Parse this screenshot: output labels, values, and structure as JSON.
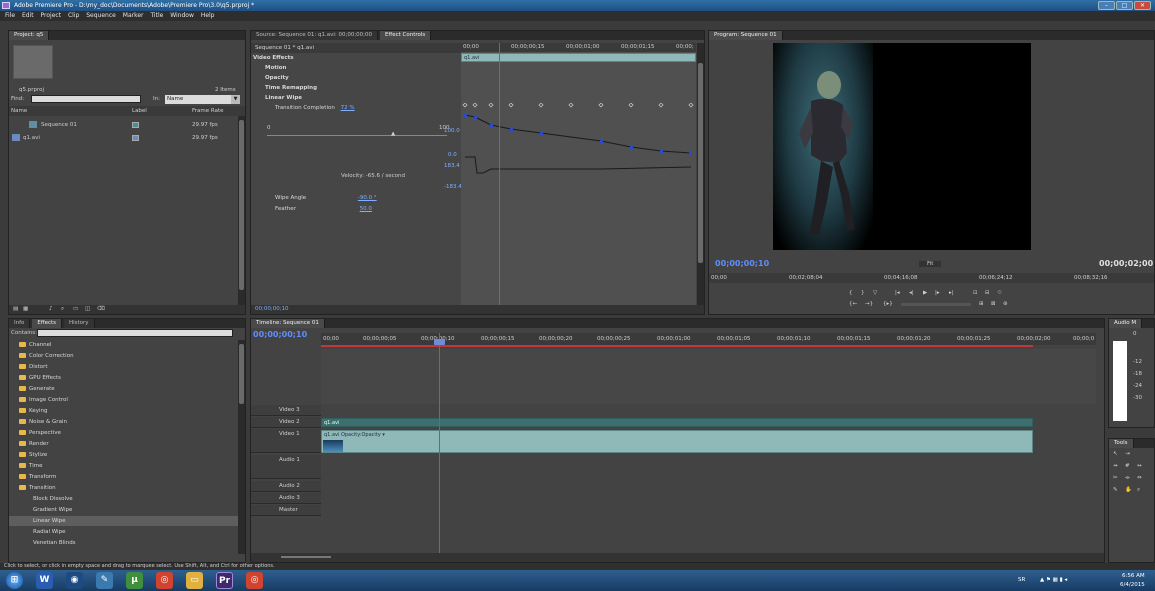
{
  "window": {
    "title": "Adobe Premiere Pro - D:\\my_doc\\Documents\\Adobe\\Premiere Pro\\3.0\\q5.prproj *"
  },
  "menu": [
    "File",
    "Edit",
    "Project",
    "Clip",
    "Sequence",
    "Marker",
    "Title",
    "Window",
    "Help"
  ],
  "project": {
    "tab": "Project: q5",
    "file": "q5.prproj",
    "count": "2 Items",
    "find_label": "Find:",
    "in_label": "In:",
    "in_value": "Name",
    "columns": [
      "Name",
      "Label",
      "Frame Rate"
    ],
    "items": [
      {
        "name": "Sequence 01",
        "rate": "29.97 fps",
        "color": "#4a8f8f"
      },
      {
        "name": "q1.avi",
        "rate": "29.97 fps",
        "color": "#6a8ac0"
      }
    ]
  },
  "source_tab": "Source: Sequence 01: q1.avi: 00;00;00;00",
  "effect_controls": {
    "tab": "Effect Controls",
    "clip_title": "Sequence 01 * q1.avi",
    "ruler": [
      "00;00",
      "00;00;00;15",
      "00;00;01;00",
      "00;00;01;15",
      "00;00;"
    ],
    "clip_name": "q1.avi",
    "video_effects": "Video Effects",
    "effects": [
      "Motion",
      "Opacity",
      "Time Remapping",
      "Linear Wipe"
    ],
    "transition_label": "Transition Completion",
    "transition_value": "72 %",
    "graph_values": [
      "100.0",
      "0.0",
      "183.4",
      "-183.4"
    ],
    "slider_min": "0",
    "slider_max": "100",
    "velocity": "Velocity: -65.6 / second",
    "wipe_angle_label": "Wipe Angle",
    "wipe_angle_value": "-90.0 °",
    "feather_label": "Feather",
    "feather_value": "50.0",
    "timecode": "00;00;00;10"
  },
  "program": {
    "tab": "Program: Sequence 01",
    "timecode": "00;00;00;10",
    "fit": "Fit",
    "duration": "00;00;02;00",
    "ruler": [
      "00;00",
      "00;02;08;04",
      "00;04;16;08",
      "00;06;24;12",
      "00;08;32;16"
    ]
  },
  "effects_panel": {
    "tabs": [
      "Info",
      "Effects",
      "History"
    ],
    "contains_label": "Contains:",
    "folders": [
      "Channel",
      "Color Correction",
      "Distort",
      "GPU Effects",
      "Generate",
      "Image Control",
      "Keying",
      "Noise & Grain",
      "Perspective",
      "Render",
      "Stylize",
      "Time",
      "Transform",
      "Transition"
    ],
    "transition_items": [
      "Block Dissolve",
      "Gradient Wipe",
      "Linear Wipe",
      "Radial Wipe",
      "Venetian Blinds"
    ],
    "selected": "Linear Wipe"
  },
  "timeline": {
    "tab": "Timeline: Sequence 01",
    "timecode": "00;00;00;10",
    "ruler": [
      "00;00",
      "00;00;00;05",
      "00;00;00;10",
      "00;00;00;15",
      "00;00;00;20",
      "00;00;00;25",
      "00;00;01;00",
      "00;00;01;05",
      "00;00;01;10",
      "00;00;01;15",
      "00;00;01;20",
      "00;00;01;25",
      "00;00;02;00",
      "00;00;0"
    ],
    "tracks": [
      "Video 3",
      "Video 2",
      "Video 1",
      "Audio 1",
      "Audio 2",
      "Audio 3",
      "Master"
    ],
    "clip_v2": "q1.avi",
    "clip_v1": "q1.avi Opacity:Opacity ▾"
  },
  "audio_master": {
    "tab": "Audio M",
    "value": "0",
    "scale": [
      "-12",
      "-18",
      "-24",
      "-30"
    ]
  },
  "tools": {
    "tab": "Tools"
  },
  "status": "Click to select, or click in empty space and drag to marquee select. Use Shift, Alt, and Ctrl for other options.",
  "taskbar": {
    "lang": "SR",
    "time": "6:56 AM",
    "date": "6/4/2015",
    "apps": [
      "start",
      "word",
      "firefox",
      "paint",
      "utorrent",
      "chrome",
      "explorer",
      "premiere",
      "chrome2"
    ]
  },
  "colors": {
    "accent_timecode": "#5f8dff",
    "playhead": "#d84040",
    "clip": "#8fb8b8"
  }
}
